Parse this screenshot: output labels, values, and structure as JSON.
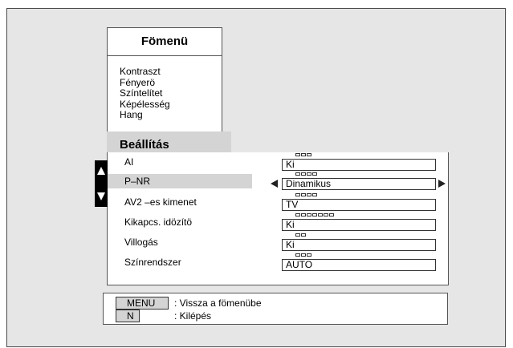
{
  "main_menu": {
    "title": "Fömenü",
    "items": [
      "Kontraszt",
      "Fényerö",
      "Színtelítet",
      "Képélesség",
      "Hang"
    ]
  },
  "section": {
    "title": "Beállítás"
  },
  "settings": [
    {
      "label": "AI",
      "value": "Ki",
      "options_count": 3,
      "selected": false
    },
    {
      "label": "P–NR",
      "value": "Dinamikus",
      "options_count": 4,
      "selected": true
    },
    {
      "label": "AV2 –es kimenet",
      "value": "TV",
      "options_count": 4,
      "selected": false
    },
    {
      "label": "Kikapcs. idözítö",
      "value": "Ki",
      "options_count": 7,
      "selected": false
    },
    {
      "label": "Villogás",
      "value": "Ki",
      "options_count": 2,
      "selected": false
    },
    {
      "label": "Színrendszer",
      "value": "AUTO",
      "options_count": 3,
      "selected": false
    }
  ],
  "help": [
    {
      "key": "MENU",
      "description": ": Vissza a fömenübe"
    },
    {
      "key": "N",
      "description": ": Kilépés"
    }
  ],
  "colors": {
    "background": "#e6e6e6",
    "panel": "#ffffff",
    "highlight": "#d4d4d4",
    "indicator": "#000000"
  },
  "icons": [
    "scroll-up-arrow-icon",
    "scroll-down-arrow-icon",
    "value-left-arrow-icon",
    "value-right-arrow-icon"
  ]
}
